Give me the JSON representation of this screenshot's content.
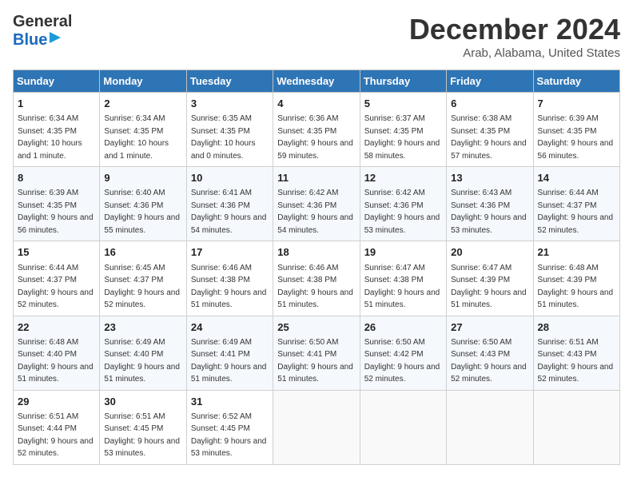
{
  "header": {
    "logo_line1": "General",
    "logo_line2": "Blue",
    "month": "December 2024",
    "location": "Arab, Alabama, United States"
  },
  "days_of_week": [
    "Sunday",
    "Monday",
    "Tuesday",
    "Wednesday",
    "Thursday",
    "Friday",
    "Saturday"
  ],
  "weeks": [
    [
      {
        "day": "1",
        "sunrise": "6:34 AM",
        "sunset": "4:35 PM",
        "daylight": "10 hours and 1 minute."
      },
      {
        "day": "2",
        "sunrise": "6:34 AM",
        "sunset": "4:35 PM",
        "daylight": "10 hours and 1 minute."
      },
      {
        "day": "3",
        "sunrise": "6:35 AM",
        "sunset": "4:35 PM",
        "daylight": "10 hours and 0 minutes."
      },
      {
        "day": "4",
        "sunrise": "6:36 AM",
        "sunset": "4:35 PM",
        "daylight": "9 hours and 59 minutes."
      },
      {
        "day": "5",
        "sunrise": "6:37 AM",
        "sunset": "4:35 PM",
        "daylight": "9 hours and 58 minutes."
      },
      {
        "day": "6",
        "sunrise": "6:38 AM",
        "sunset": "4:35 PM",
        "daylight": "9 hours and 57 minutes."
      },
      {
        "day": "7",
        "sunrise": "6:39 AM",
        "sunset": "4:35 PM",
        "daylight": "9 hours and 56 minutes."
      }
    ],
    [
      {
        "day": "8",
        "sunrise": "6:39 AM",
        "sunset": "4:35 PM",
        "daylight": "9 hours and 56 minutes."
      },
      {
        "day": "9",
        "sunrise": "6:40 AM",
        "sunset": "4:36 PM",
        "daylight": "9 hours and 55 minutes."
      },
      {
        "day": "10",
        "sunrise": "6:41 AM",
        "sunset": "4:36 PM",
        "daylight": "9 hours and 54 minutes."
      },
      {
        "day": "11",
        "sunrise": "6:42 AM",
        "sunset": "4:36 PM",
        "daylight": "9 hours and 54 minutes."
      },
      {
        "day": "12",
        "sunrise": "6:42 AM",
        "sunset": "4:36 PM",
        "daylight": "9 hours and 53 minutes."
      },
      {
        "day": "13",
        "sunrise": "6:43 AM",
        "sunset": "4:36 PM",
        "daylight": "9 hours and 53 minutes."
      },
      {
        "day": "14",
        "sunrise": "6:44 AM",
        "sunset": "4:37 PM",
        "daylight": "9 hours and 52 minutes."
      }
    ],
    [
      {
        "day": "15",
        "sunrise": "6:44 AM",
        "sunset": "4:37 PM",
        "daylight": "9 hours and 52 minutes."
      },
      {
        "day": "16",
        "sunrise": "6:45 AM",
        "sunset": "4:37 PM",
        "daylight": "9 hours and 52 minutes."
      },
      {
        "day": "17",
        "sunrise": "6:46 AM",
        "sunset": "4:38 PM",
        "daylight": "9 hours and 51 minutes."
      },
      {
        "day": "18",
        "sunrise": "6:46 AM",
        "sunset": "4:38 PM",
        "daylight": "9 hours and 51 minutes."
      },
      {
        "day": "19",
        "sunrise": "6:47 AM",
        "sunset": "4:38 PM",
        "daylight": "9 hours and 51 minutes."
      },
      {
        "day": "20",
        "sunrise": "6:47 AM",
        "sunset": "4:39 PM",
        "daylight": "9 hours and 51 minutes."
      },
      {
        "day": "21",
        "sunrise": "6:48 AM",
        "sunset": "4:39 PM",
        "daylight": "9 hours and 51 minutes."
      }
    ],
    [
      {
        "day": "22",
        "sunrise": "6:48 AM",
        "sunset": "4:40 PM",
        "daylight": "9 hours and 51 minutes."
      },
      {
        "day": "23",
        "sunrise": "6:49 AM",
        "sunset": "4:40 PM",
        "daylight": "9 hours and 51 minutes."
      },
      {
        "day": "24",
        "sunrise": "6:49 AM",
        "sunset": "4:41 PM",
        "daylight": "9 hours and 51 minutes."
      },
      {
        "day": "25",
        "sunrise": "6:50 AM",
        "sunset": "4:41 PM",
        "daylight": "9 hours and 51 minutes."
      },
      {
        "day": "26",
        "sunrise": "6:50 AM",
        "sunset": "4:42 PM",
        "daylight": "9 hours and 52 minutes."
      },
      {
        "day": "27",
        "sunrise": "6:50 AM",
        "sunset": "4:43 PM",
        "daylight": "9 hours and 52 minutes."
      },
      {
        "day": "28",
        "sunrise": "6:51 AM",
        "sunset": "4:43 PM",
        "daylight": "9 hours and 52 minutes."
      }
    ],
    [
      {
        "day": "29",
        "sunrise": "6:51 AM",
        "sunset": "4:44 PM",
        "daylight": "9 hours and 52 minutes."
      },
      {
        "day": "30",
        "sunrise": "6:51 AM",
        "sunset": "4:45 PM",
        "daylight": "9 hours and 53 minutes."
      },
      {
        "day": "31",
        "sunrise": "6:52 AM",
        "sunset": "4:45 PM",
        "daylight": "9 hours and 53 minutes."
      },
      null,
      null,
      null,
      null
    ]
  ],
  "labels": {
    "sunrise": "Sunrise:",
    "sunset": "Sunset:",
    "daylight": "Daylight:"
  }
}
